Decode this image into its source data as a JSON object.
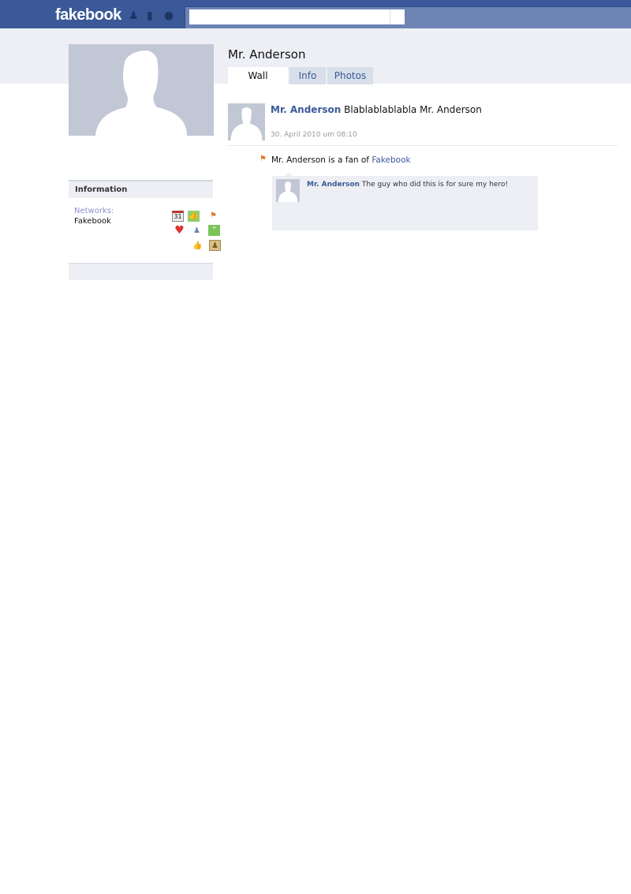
{
  "header": {
    "logo": "fakebook",
    "search_placeholder": "",
    "nav_icons": [
      "friends-icon",
      "messages-icon",
      "notifications-globe-icon"
    ]
  },
  "profile": {
    "name": "Mr. Anderson",
    "tabs": [
      {
        "label": "Wall",
        "active": true
      },
      {
        "label": "Info",
        "active": false
      },
      {
        "label": "Photos",
        "active": false
      }
    ]
  },
  "post": {
    "author": "Mr. Anderson",
    "text": "Blablablablabla Mr. Anderson",
    "date": "30. April  2010 um 08:10"
  },
  "activity": {
    "text": "Mr. Anderson is a fan of ",
    "link": "Fakebook"
  },
  "comment": {
    "author": "Mr. Anderson",
    "text": "The guy who did this is for sure my hero!"
  },
  "information": {
    "title": "Information",
    "networks_label": "Networks:",
    "networks_value": "Fakebook",
    "calendar_day": "31",
    "icons": [
      "calendar-icon",
      "like-green-icon",
      "fan-flag-icon",
      "heart-icon",
      "friend-add-icon",
      "chat-icon",
      "thumbs-up-icon",
      "photo-album-icon"
    ]
  },
  "colors": {
    "brand": "#3b5998",
    "band": "#edeff4",
    "placeholder_avatar": "#c1c7d5"
  }
}
